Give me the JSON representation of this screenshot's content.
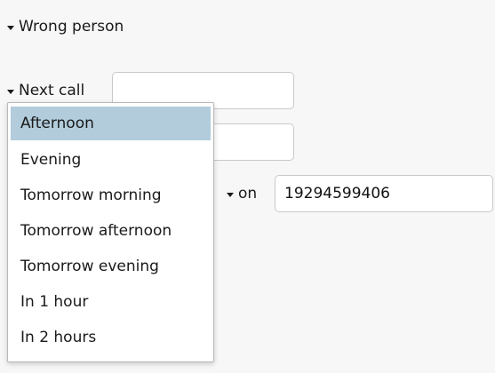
{
  "form": {
    "wrong_person_label": "Wrong person",
    "next_call_label": "Next call",
    "next_call_value": "",
    "second_field_value": "",
    "on_label": "on",
    "phone_value": "19294599406"
  },
  "dropdown": {
    "selected": "Afternoon",
    "options": [
      "Afternoon",
      "Evening",
      "Tomorrow morning",
      "Tomorrow afternoon",
      "Tomorrow evening",
      "In 1 hour",
      "In 2 hours"
    ]
  },
  "colors": {
    "selected_option_bg": "#b2ccdb",
    "page_bg": "#f7f7f7"
  }
}
